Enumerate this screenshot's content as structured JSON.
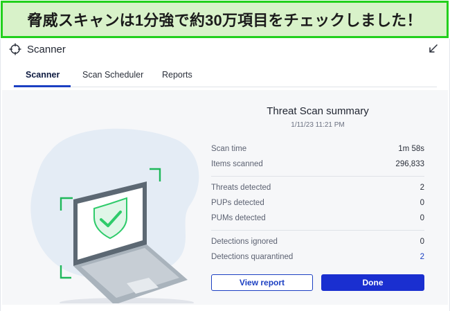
{
  "banner": {
    "text": "脅威スキャンは1分強で約30万項目をチェックしました！"
  },
  "window": {
    "title": "Scanner"
  },
  "tabs": [
    {
      "label": "Scanner",
      "active": true
    },
    {
      "label": "Scan Scheduler",
      "active": false
    },
    {
      "label": "Reports",
      "active": false
    }
  ],
  "summary": {
    "title": "Threat Scan summary",
    "date": "1/11/23 11:21 PM",
    "scan_time": {
      "label": "Scan time",
      "value": "1m 58s"
    },
    "items_scanned": {
      "label": "Items scanned",
      "value": "296,833"
    },
    "threats": {
      "label": "Threats detected",
      "value": "2"
    },
    "pups": {
      "label": "PUPs detected",
      "value": "0"
    },
    "pums": {
      "label": "PUMs detected",
      "value": "0"
    },
    "ignored": {
      "label": "Detections ignored",
      "value": "0"
    },
    "quarantined": {
      "label": "Detections quarantined",
      "value": "2"
    }
  },
  "buttons": {
    "view_report": "View report",
    "done": "Done"
  },
  "icons": {
    "app": "crosshair-icon",
    "shrink": "arrow-down-left-icon",
    "illustration": "laptop-shield-check-icon"
  },
  "colors": {
    "banner_bg": "#d8f2c9",
    "banner_border": "#22d01c",
    "accent": "#1b3fc2",
    "done_bg": "#1a2fd0",
    "check_green": "#2ecb6a"
  }
}
